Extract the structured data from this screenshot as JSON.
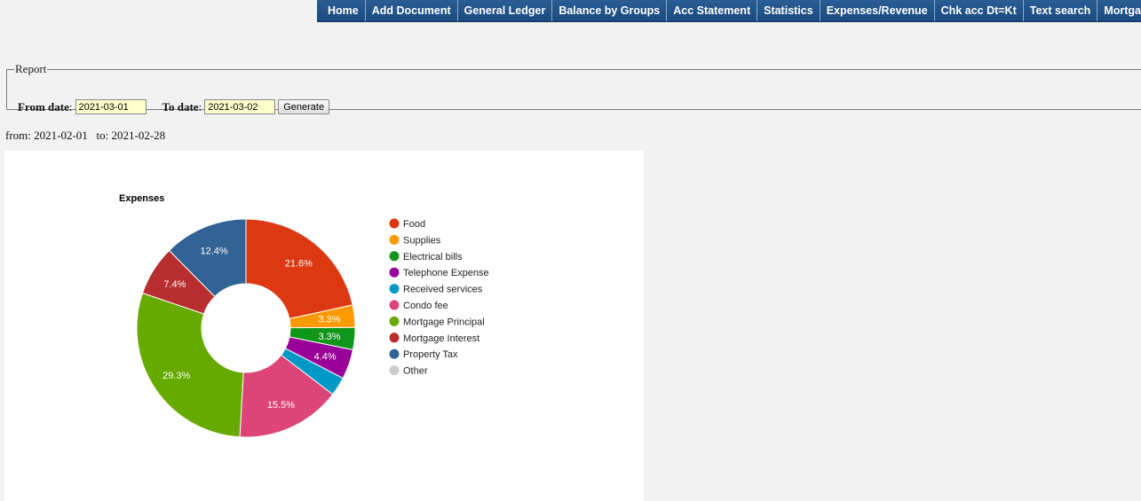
{
  "nav": {
    "items": [
      "Home",
      "Add Document",
      "General Ledger",
      "Balance by Groups",
      "Acc Statement",
      "Statistics",
      "Expenses/Revenue",
      "Chk acc Dt=Kt",
      "Text search",
      "Mortgage"
    ]
  },
  "report": {
    "legend": "Report",
    "from_label": "From date",
    "from_value": "2021-03-01",
    "to_label": "To date",
    "to_value": "2021-03-02",
    "generate_label": "Generate"
  },
  "range_text": "from: 2021-02-01   to: 2021-02-28",
  "chart_data": {
    "type": "pie",
    "title": "Expenses",
    "legend_position": "right",
    "categories": [
      "Food",
      "Supplies",
      "Electrical bills",
      "Telephone Expense",
      "Received services",
      "Condo fee",
      "Mortgage Principal",
      "Mortgage Interest",
      "Property Tax",
      "Other"
    ],
    "values": [
      21.6,
      3.3,
      3.3,
      4.4,
      2.8,
      15.5,
      29.3,
      7.4,
      12.4,
      0
    ],
    "labels": [
      "21.6%",
      "3.3%",
      "3.3%",
      "4.4%",
      "",
      "15.5%",
      "29.3%",
      "7.4%",
      "12.4%",
      ""
    ],
    "colors": [
      "#dc3912",
      "#ff9900",
      "#109618",
      "#990099",
      "#0099c6",
      "#dd4477",
      "#66aa00",
      "#b82e2e",
      "#316395",
      "#cccccc"
    ]
  }
}
